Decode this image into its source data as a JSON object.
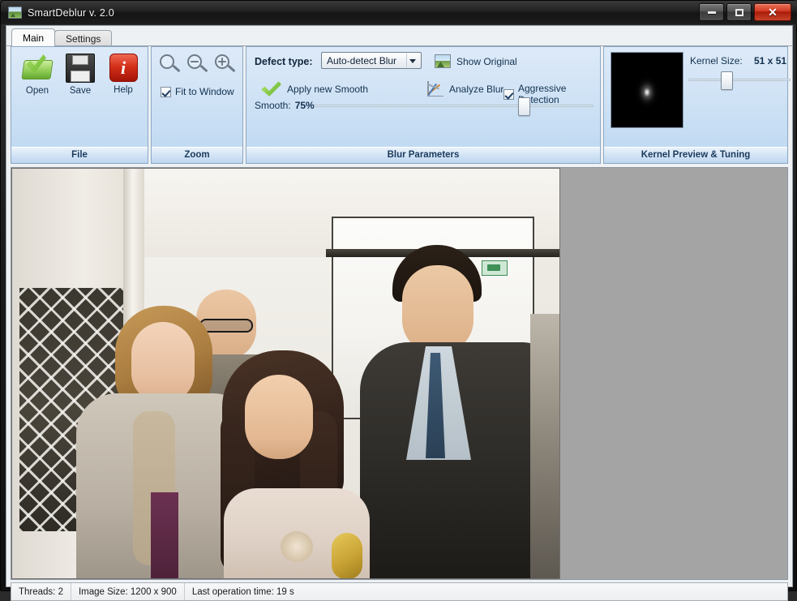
{
  "window": {
    "title": "SmartDeblur v. 2.0",
    "icon": "image-icon",
    "controls": {
      "minimize": "minimize-button",
      "maximize": "maximize-button",
      "close": "✕"
    }
  },
  "tabs": [
    {
      "label": "Main",
      "active": true
    },
    {
      "label": "Settings",
      "active": false
    }
  ],
  "ribbon": {
    "groups": [
      {
        "caption": "File",
        "buttons": [
          {
            "label": "Open",
            "icon": "open-folder-icon"
          },
          {
            "label": "Save",
            "icon": "floppy-disk-icon"
          },
          {
            "label": "Help",
            "icon": "info-icon"
          }
        ]
      },
      {
        "caption": "Zoom",
        "buttons": [
          {
            "icon": "zoom-actual-icon"
          },
          {
            "icon": "zoom-out-icon"
          },
          {
            "icon": "zoom-in-icon"
          }
        ],
        "checkbox": {
          "label": "Fit to Window",
          "checked": true
        }
      },
      {
        "caption": "Blur Parameters",
        "defect_type_label": "Defect type:",
        "defect_type_value": "Auto-detect Blur",
        "defect_type_options": [
          "Auto-detect Blur"
        ],
        "show_original_label": "Show Original",
        "apply_label": "Apply new Smooth",
        "analyze_label": "Analyze Blur",
        "aggressive_label": "Aggressive Detection",
        "aggressive_checked": true,
        "smooth_label": "Smooth:",
        "smooth_value": "75%",
        "smooth_percent": 75
      },
      {
        "caption": "Kernel Preview & Tuning",
        "kernel_size_label": "Kernel Size:",
        "kernel_size_value": "51 x 51",
        "kernel_slider_percent": 34,
        "preview_icon": "kernel-psf-preview"
      }
    ]
  },
  "canvas": {
    "background_color": "#a4a4a4",
    "image_alt": "deblurred group photo"
  },
  "statusbar": {
    "threads": "Threads: 2",
    "image_size": "Image Size: 1200 x 900",
    "last_operation": "Last operation time: 19 s"
  },
  "colors": {
    "ribbon_top": "#ddeaf8",
    "ribbon_bottom": "#bdd8f1",
    "accent_green": "#7cc13e",
    "accent_red": "#d4301a",
    "canvas_gray": "#a4a4a4"
  }
}
